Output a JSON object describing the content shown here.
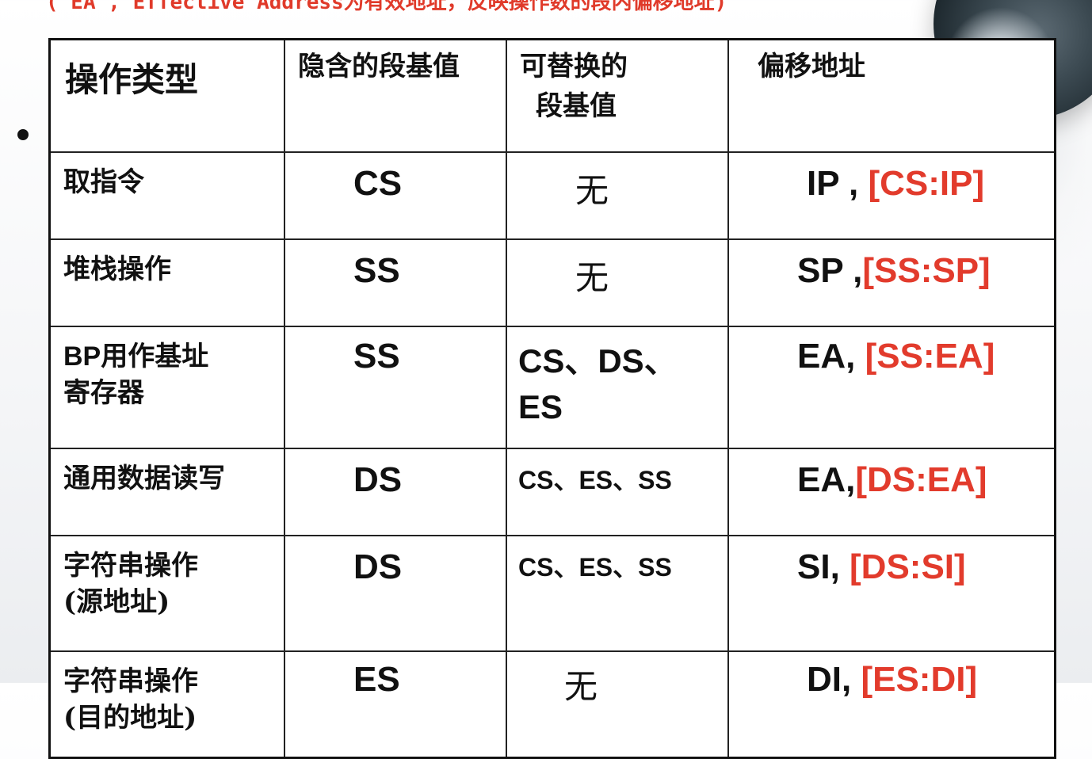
{
  "slide": {
    "note": "( EA , Effective Address为有效地址，反映操作数的段内偏移地址)"
  },
  "table": {
    "headers": {
      "op_type": "操作类型",
      "implied_seg": "隐含的段基值",
      "alt_seg_line1": "可替换的",
      "alt_seg_line2": "段基值",
      "offset": "偏移地址"
    },
    "rows": [
      {
        "op_line1": "取指令",
        "op_line2": "",
        "implied": "CS",
        "alt_line1": "无",
        "alt_line2": "",
        "offset_reg": "IP , ",
        "offset_addr": "[CS:IP]"
      },
      {
        "op_line1": "堆栈操作",
        "op_line2": "",
        "implied": "SS",
        "alt_line1": "无",
        "alt_line2": "",
        "offset_reg": "SP ,",
        "offset_addr": "[SS:SP]"
      },
      {
        "op_line1": "BP用作基址",
        "op_line2": "寄存器",
        "implied": "SS",
        "alt_line1": "CS、DS、",
        "alt_line2": "ES",
        "offset_reg": "EA, ",
        "offset_addr": "[SS:EA]"
      },
      {
        "op_line1": "通用数据读写",
        "op_line2": "",
        "implied": "DS",
        "alt_line1": "CS、ES、SS",
        "alt_line2": "",
        "offset_reg": "EA,",
        "offset_addr": "[DS:EA]"
      },
      {
        "op_line1": "字符串操作",
        "op_line2": "(源地址)",
        "implied": "DS",
        "alt_line1": "CS、ES、SS",
        "alt_line2": "",
        "offset_reg": "SI, ",
        "offset_addr": "[DS:SI]"
      },
      {
        "op_line1": "字符串操作",
        "op_line2": "(目的地址)",
        "implied": "ES",
        "alt_line1": "无",
        "alt_line2": "",
        "offset_reg": "DI, ",
        "offset_addr": "[ES:DI]"
      }
    ]
  },
  "colors": {
    "note": "#e03a2a",
    "highlight": "#e23b2c",
    "text": "#111111"
  }
}
